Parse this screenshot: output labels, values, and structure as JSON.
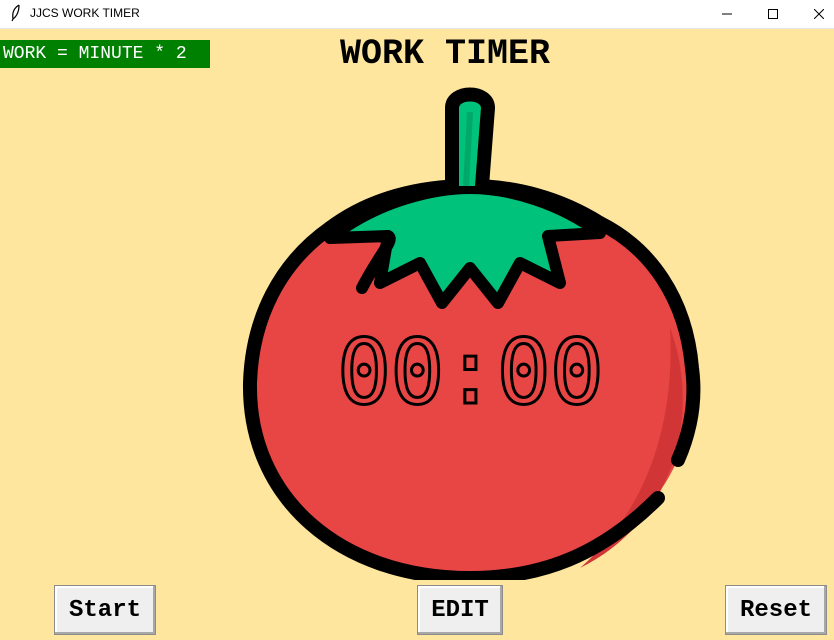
{
  "window": {
    "title": "JJCS WORK TIMER",
    "controls": [
      "minimize-icon",
      "maximize-icon",
      "close-icon"
    ]
  },
  "badge": {
    "text": "WORK = MINUTE * 2",
    "background": "#008000",
    "color": "#ffffff"
  },
  "heading": "WORK TIMER",
  "timer": {
    "display": "00:00"
  },
  "buttons": {
    "start_label": "Start",
    "edit_label": "EDIT",
    "reset_label": "Reset"
  },
  "colors": {
    "background": "#fee69e",
    "tomato": "#e84545",
    "leaves": "#00c27a",
    "outline": "#000000"
  }
}
